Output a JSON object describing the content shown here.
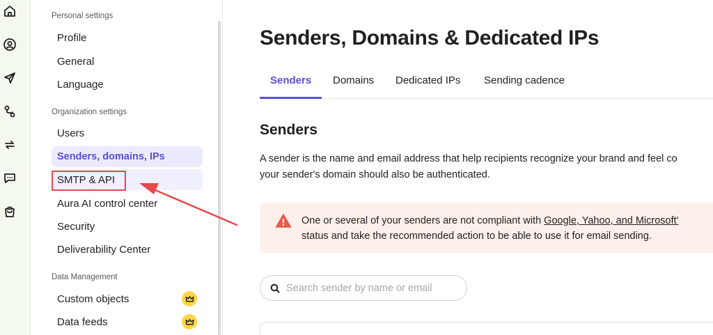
{
  "rail": {
    "icons": [
      "home-icon",
      "user-circle-icon",
      "send-icon",
      "automation-icon",
      "transfer-icon",
      "chat-icon",
      "shopping-bag-icon"
    ]
  },
  "sidebar": {
    "personal_label": "Personal settings",
    "personal_items": [
      {
        "label": "Profile"
      },
      {
        "label": "General"
      },
      {
        "label": "Language"
      }
    ],
    "org_label": "Organization settings",
    "org_items": [
      {
        "label": "Users"
      },
      {
        "label": "Senders, domains, IPs",
        "active": true
      },
      {
        "label": "SMTP & API",
        "highlighted": true
      },
      {
        "label": "Aura AI control center"
      },
      {
        "label": "Security"
      },
      {
        "label": "Deliverability Center"
      }
    ],
    "data_label": "Data Management",
    "data_items": [
      {
        "label": "Custom objects",
        "badge": "crown-icon"
      },
      {
        "label": "Data feeds",
        "badge": "crown-icon"
      }
    ]
  },
  "main": {
    "title": "Senders, Domains & Dedicated IPs",
    "tabs": [
      {
        "label": "Senders",
        "active": true
      },
      {
        "label": "Domains"
      },
      {
        "label": "Dedicated IPs"
      },
      {
        "label": "Sending cadence"
      }
    ],
    "section_title": "Senders",
    "description_line1": "A sender is the name and email address that help recipients recognize your brand and feel co",
    "description_line2": "your sender's domain should also be authenticated.",
    "alert": {
      "text_before_link": "One or several of your senders are not compliant with ",
      "link": "Google, Yahoo, and Microsoft'",
      "line2": "status and take the recommended action to be able to use it for email sending."
    },
    "search": {
      "placeholder": "Search sender by name or email"
    }
  },
  "colors": {
    "accent": "#5b4ed8",
    "active_bg": "#eceafd",
    "rail_bg": "#f3f9ef",
    "alert_bg": "#fdf0ea",
    "warning": "#e8594a",
    "annotation": "#e8474c",
    "crown_badge": "#ffd54a"
  }
}
